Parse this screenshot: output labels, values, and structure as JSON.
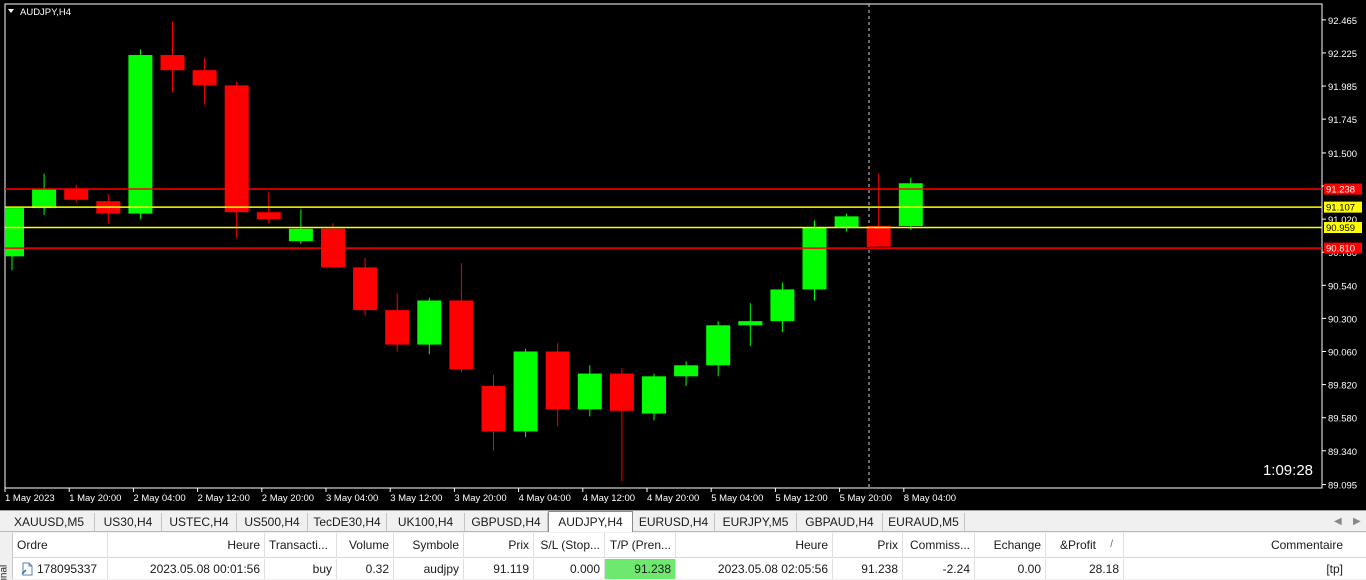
{
  "chart": {
    "title": "AUDJPY,H4",
    "countdown": "1:09:28",
    "colors": {
      "bull": "#00ff00",
      "bear": "#ff0000",
      "tp_line": "#ff0000",
      "entry_line": "#ffff00",
      "background": "#000000",
      "axis": "#ffffff"
    }
  },
  "chart_data": {
    "type": "candlestick",
    "symbol": "AUDJPY",
    "timeframe": "H4",
    "ylim": [
      89.07,
      92.58
    ],
    "price_ticks": [
      "92.465",
      "92.225",
      "91.985",
      "91.745",
      "91.500",
      "91.260",
      "91.020",
      "90.780",
      "90.540",
      "90.300",
      "90.060",
      "89.820",
      "89.580",
      "89.340",
      "89.095"
    ],
    "time_labels": [
      "1 May 2023",
      "1 May 20:00",
      "2 May 04:00",
      "2 May 12:00",
      "2 May 20:00",
      "3 May 04:00",
      "3 May 12:00",
      "3 May 20:00",
      "4 May 04:00",
      "4 May 12:00",
      "4 May 20:00",
      "5 May 04:00",
      "5 May 12:00",
      "5 May 20:00",
      "8 May 04:00"
    ],
    "candles": [
      {
        "o": 90.75,
        "h": 91.1,
        "l": 90.65,
        "c": 91.1
      },
      {
        "o": 91.1,
        "h": 91.35,
        "l": 91.05,
        "c": 91.24
      },
      {
        "o": 91.24,
        "h": 91.27,
        "l": 91.14,
        "c": 91.16
      },
      {
        "o": 91.15,
        "h": 91.2,
        "l": 90.99,
        "c": 91.06
      },
      {
        "o": 91.06,
        "h": 92.25,
        "l": 91.02,
        "c": 92.21
      },
      {
        "o": 92.21,
        "h": 92.45,
        "l": 91.94,
        "c": 92.1
      },
      {
        "o": 92.1,
        "h": 92.19,
        "l": 91.85,
        "c": 91.99
      },
      {
        "o": 91.99,
        "h": 92.02,
        "l": 90.88,
        "c": 91.07
      },
      {
        "o": 91.07,
        "h": 91.22,
        "l": 90.99,
        "c": 91.02
      },
      {
        "o": 90.86,
        "h": 91.09,
        "l": 90.84,
        "c": 90.95
      },
      {
        "o": 90.95,
        "h": 90.99,
        "l": 90.67,
        "c": 90.67
      },
      {
        "o": 90.67,
        "h": 90.74,
        "l": 90.32,
        "c": 90.36
      },
      {
        "o": 90.36,
        "h": 90.48,
        "l": 90.06,
        "c": 90.11
      },
      {
        "o": 90.11,
        "h": 90.45,
        "l": 90.04,
        "c": 90.43
      },
      {
        "o": 90.43,
        "h": 90.7,
        "l": 89.91,
        "c": 89.93
      },
      {
        "o": 89.81,
        "h": 89.89,
        "l": 89.34,
        "c": 89.48
      },
      {
        "o": 89.48,
        "h": 90.08,
        "l": 89.44,
        "c": 90.06
      },
      {
        "o": 90.06,
        "h": 90.12,
        "l": 89.52,
        "c": 89.64
      },
      {
        "o": 89.64,
        "h": 89.96,
        "l": 89.59,
        "c": 89.9
      },
      {
        "o": 89.9,
        "h": 89.94,
        "l": 89.12,
        "c": 89.63
      },
      {
        "o": 89.61,
        "h": 89.9,
        "l": 89.56,
        "c": 89.88
      },
      {
        "o": 89.88,
        "h": 89.99,
        "l": 89.81,
        "c": 89.96
      },
      {
        "o": 89.96,
        "h": 90.28,
        "l": 89.88,
        "c": 90.25
      },
      {
        "o": 90.25,
        "h": 90.41,
        "l": 90.1,
        "c": 90.28
      },
      {
        "o": 90.28,
        "h": 90.56,
        "l": 90.2,
        "c": 90.51
      },
      {
        "o": 90.51,
        "h": 91.01,
        "l": 90.43,
        "c": 90.96
      },
      {
        "o": 90.96,
        "h": 91.06,
        "l": 90.93,
        "c": 91.04
      },
      {
        "o": 90.97,
        "h": 91.35,
        "l": 90.82,
        "c": 90.82
      },
      {
        "o": 90.97,
        "h": 91.32,
        "l": 90.94,
        "c": 91.28
      }
    ],
    "horizontal_lines": [
      {
        "price": 91.238,
        "label": "91.238",
        "color": "#ff0000"
      },
      {
        "price": 91.107,
        "label": "91.107",
        "color": "#ffff00"
      },
      {
        "price": 90.959,
        "label": "90.959",
        "color": "#ffff00"
      },
      {
        "price": 90.81,
        "label": "90.810",
        "color": "#ff0000"
      }
    ]
  },
  "tabs": [
    {
      "label": "XAUUSD,M5"
    },
    {
      "label": "US30,H4"
    },
    {
      "label": "USTEC,H4"
    },
    {
      "label": "US500,H4"
    },
    {
      "label": "TecDE30,H4"
    },
    {
      "label": "UK100,H4"
    },
    {
      "label": "GBPUSD,H4"
    },
    {
      "label": "AUDJPY,H4",
      "active": true
    },
    {
      "label": "EURUSD,H4"
    },
    {
      "label": "EURJPY,M5"
    },
    {
      "label": "GBPAUD,H4"
    },
    {
      "label": "EURAUD,M5"
    }
  ],
  "terminal": {
    "side_label": "inal",
    "columns": [
      "Ordre",
      "Heure",
      "Transacti...",
      "Volume",
      "Symbole",
      "Prix",
      "S/L (Stop...",
      "T/P (Pren...",
      "Heure",
      "Prix",
      "Commiss...",
      "Echange",
      "&Profit",
      "Commentaire"
    ],
    "sort_indicator": "/",
    "row": {
      "order": "178095337",
      "open_time": "2023.05.08 00:01:56",
      "type": "buy",
      "volume": "0.32",
      "symbol": "audjpy",
      "open_price": "91.119",
      "sl": "0.000",
      "tp": "91.238",
      "close_time": "2023.05.08 02:05:56",
      "close_price": "91.238",
      "commission": "-2.24",
      "swap": "0.00",
      "profit": "28.18",
      "comment": "[tp]"
    }
  }
}
